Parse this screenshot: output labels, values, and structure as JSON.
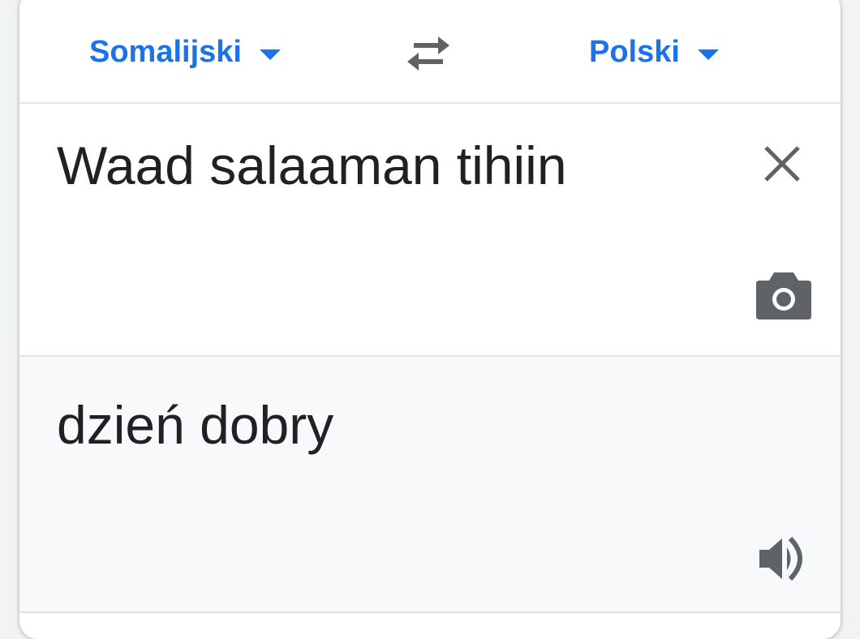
{
  "languages": {
    "source_label": "Somalijski",
    "target_label": "Polski"
  },
  "input": {
    "text": "Waad salaaman tihiin"
  },
  "output": {
    "text": "dzień dobry"
  },
  "icons": {
    "swap": "swap-arrows-icon",
    "clear": "close-icon",
    "camera": "camera-icon",
    "speaker": "speaker-icon"
  },
  "colors": {
    "accent": "#1a73e8",
    "text": "#202124",
    "icon": "#5f6368",
    "output_bg": "#f8f9fa"
  }
}
